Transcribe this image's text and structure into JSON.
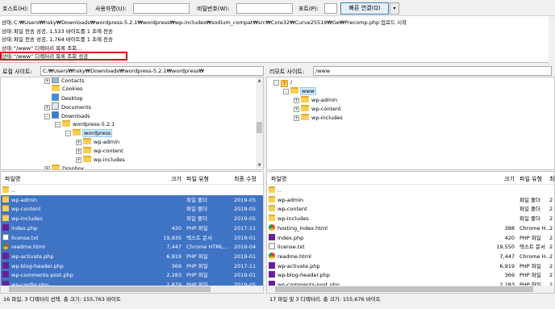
{
  "quickconnect": {
    "host_label": "호스트(H):",
    "user_label": "사용자명(U):",
    "pass_label": "비밀번호(W):",
    "port_label": "포트(P):",
    "connect_label": "빠른 연결(Q)",
    "dropdown_glyph": "▾"
  },
  "log": {
    "lines": [
      {
        "key": "상태:",
        "text": "C:₩Users₩hsky₩Downloads₩wordpress-5.2.1₩wordpress₩wp-includes₩sodium_compat₩src₩Core32₩Curve25519₩Ge₩Precomp.php 업로드 시작"
      },
      {
        "key": "상태:",
        "text": "파일 전송 성공, 1,533 바이트를 1 초에 전송"
      },
      {
        "key": "상태:",
        "text": "파일 전송 성공, 1,764 바이트를 1 초에 전송"
      },
      {
        "key": "상태:",
        "text": "\"/www\" 디렉터리 목록 조회..."
      },
      {
        "key": "상태:",
        "text": "\"/www\" 디렉터리 목록 조회 성공"
      }
    ]
  },
  "local": {
    "site_label": "로컬 사이트:",
    "path": "C:₩Users₩hsky₩Downloads₩wordpress-5.2.1₩wordpress₩",
    "tree": [
      {
        "label": "Contacts",
        "icon": "contacts"
      },
      {
        "label": "Cookies",
        "icon": "folder"
      },
      {
        "label": "Desktop",
        "icon": "desktop"
      },
      {
        "label": "Documents",
        "icon": "documents"
      },
      {
        "label": "Downloads",
        "icon": "downloads"
      },
      {
        "label": "wordpress-5.2.1",
        "icon": "folder"
      },
      {
        "label": "wordpress",
        "icon": "folder"
      },
      {
        "label": "wp-admin",
        "icon": "folder"
      },
      {
        "label": "wp-content",
        "icon": "folder"
      },
      {
        "label": "wp-includes",
        "icon": "folder"
      },
      {
        "label": "Dropbox",
        "icon": "folder"
      },
      {
        "label": "Evernote",
        "icon": "folder"
      }
    ],
    "headers": {
      "name": "파일명",
      "size": "크기",
      "type": "파일 유형",
      "modified": "최종 수정"
    },
    "files": [
      {
        "name": "..",
        "size": "",
        "type": "",
        "date": "",
        "icon": "folder",
        "selected": false
      },
      {
        "name": "wp-admin",
        "size": "",
        "type": "파일 폴더",
        "date": "2019-05",
        "icon": "folder",
        "selected": true
      },
      {
        "name": "wp-content",
        "size": "",
        "type": "파일 폴더",
        "date": "2019-05",
        "icon": "folder",
        "selected": true
      },
      {
        "name": "wp-includes",
        "size": "",
        "type": "파일 폴더",
        "date": "2019-05",
        "icon": "folder",
        "selected": true
      },
      {
        "name": "index.php",
        "size": "420",
        "type": "PHP 파일",
        "date": "2017-11",
        "icon": "php",
        "selected": true
      },
      {
        "name": "license.txt",
        "size": "19,935",
        "type": "텍스트 문서",
        "date": "2019-01",
        "icon": "txt",
        "selected": true
      },
      {
        "name": "readme.html",
        "size": "7,447",
        "type": "Chrome HTML...",
        "date": "2019-04",
        "icon": "chrome",
        "selected": true
      },
      {
        "name": "wp-activate.php",
        "size": "6,919",
        "type": "PHP 파일",
        "date": "2019-01",
        "icon": "php",
        "selected": true
      },
      {
        "name": "wp-blog-header.php",
        "size": "369",
        "type": "PHP 파일",
        "date": "2017-11",
        "icon": "php",
        "selected": true
      },
      {
        "name": "wp-comments-post.php",
        "size": "2,283",
        "type": "PHP 파일",
        "date": "2019-01",
        "icon": "php",
        "selected": true
      },
      {
        "name": "wp-config.php",
        "size": "2,879",
        "type": "PHP 파일",
        "date": "2019-05",
        "icon": "php",
        "selected": true
      }
    ],
    "status": "16 파일, 3 디렉터리 선택. 총 크기: 155,763 바이트"
  },
  "remote": {
    "site_label": "리모트 사이트:",
    "path": "/www",
    "tree": [
      {
        "label": "/",
        "icon": "question"
      },
      {
        "label": "www",
        "icon": "folder"
      },
      {
        "label": "wp-admin",
        "icon": "folder"
      },
      {
        "label": "wp-content",
        "icon": "folder"
      },
      {
        "label": "wp-includes",
        "icon": "folder"
      }
    ],
    "headers": {
      "name": "파일명",
      "size": "크기",
      "type": "파일 유형",
      "extra": "최"
    },
    "files": [
      {
        "name": "..",
        "size": "",
        "type": "",
        "extra": "",
        "icon": "folder"
      },
      {
        "name": "wp-admin",
        "size": "",
        "type": "파일 폴더",
        "extra": "2",
        "icon": "folder"
      },
      {
        "name": "wp-content",
        "size": "",
        "type": "파일 폴더",
        "extra": "2",
        "icon": "folder"
      },
      {
        "name": "wp-includes",
        "size": "",
        "type": "파일 폴더",
        "extra": "2",
        "icon": "folder"
      },
      {
        "name": "hosting_index.html",
        "size": "388",
        "type": "Chrome H...",
        "extra": "2",
        "icon": "chrome"
      },
      {
        "name": "index.php",
        "size": "420",
        "type": "PHP 파일",
        "extra": "2",
        "icon": "php"
      },
      {
        "name": "license.txt",
        "size": "19,550",
        "type": "텍스트 문서",
        "extra": "2",
        "icon": "txt"
      },
      {
        "name": "readme.html",
        "size": "7,447",
        "type": "Chrome H...",
        "extra": "2",
        "icon": "chrome"
      },
      {
        "name": "wp-activate.php",
        "size": "6,919",
        "type": "PHP 파일",
        "extra": "2",
        "icon": "php"
      },
      {
        "name": "wp-blog-header.php",
        "size": "369",
        "type": "PHP 파일",
        "extra": "2",
        "icon": "php"
      },
      {
        "name": "wp-comments-post.php",
        "size": "2,283",
        "type": "PHP 파일",
        "extra": "2",
        "icon": "php"
      },
      {
        "name": "wp-config.php",
        "size": "2,780",
        "type": "PHP 파일",
        "extra": "2",
        "icon": "php"
      }
    ],
    "status": "17 파일 및 3 디렉터리. 총 크기: 155,676 바이트"
  },
  "colors": {
    "selection": "#3f73c4",
    "highlight_border": "#d0021b",
    "folder": "#f6cf57",
    "php": "#6a1f9a"
  }
}
